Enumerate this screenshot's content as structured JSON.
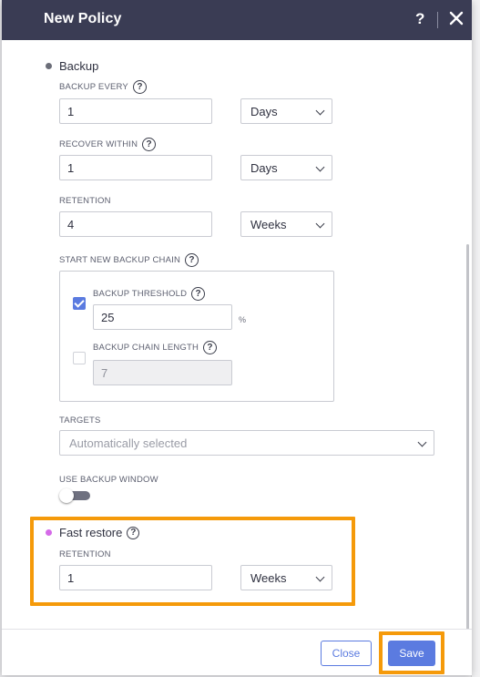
{
  "dialog": {
    "title": "New Policy",
    "help_label": "?"
  },
  "backup": {
    "section_label": "Backup",
    "dot_color": "#6b6d78",
    "backup_every": {
      "label": "BACKUP EVERY",
      "value": "1",
      "unit": "Days"
    },
    "recover_within": {
      "label": "RECOVER WITHIN",
      "value": "1",
      "unit": "Days"
    },
    "retention": {
      "label": "RETENTION",
      "value": "4",
      "unit": "Weeks"
    },
    "start_new_chain": {
      "label": "START NEW BACKUP CHAIN",
      "threshold": {
        "label": "BACKUP THRESHOLD",
        "checked": true,
        "value": "25",
        "unit": "%"
      },
      "chain_length": {
        "label": "BACKUP CHAIN LENGTH",
        "checked": false,
        "value": "7"
      }
    },
    "targets": {
      "label": "TARGETS",
      "placeholder": "Automatically selected"
    },
    "use_backup_window": {
      "label": "USE BACKUP WINDOW",
      "enabled": false
    }
  },
  "fast_restore": {
    "section_label": "Fast restore",
    "dot_color": "#d56ae8",
    "retention": {
      "label": "RETENTION",
      "value": "1",
      "unit": "Weeks"
    }
  },
  "footer": {
    "close_label": "Close",
    "save_label": "Save"
  },
  "colors": {
    "header": "#3a3c54",
    "accent": "#5b7be0",
    "highlight": "#f59a0a"
  }
}
